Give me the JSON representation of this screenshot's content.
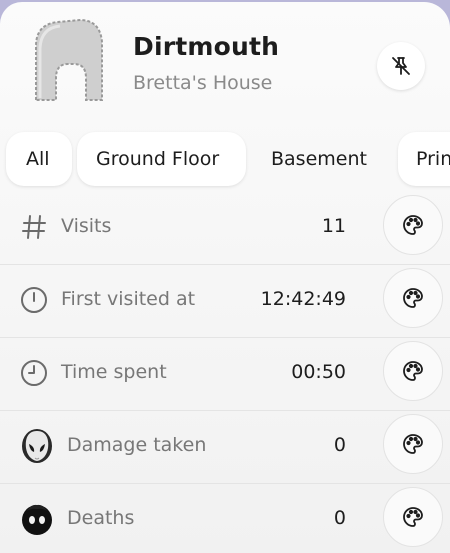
{
  "header": {
    "title": "Dirtmouth",
    "subtitle": "Bretta's House",
    "thumbnail_icon": "house-silhouette-icon",
    "unpin_icon": "pin-off-icon"
  },
  "tabs": [
    {
      "label": "All"
    },
    {
      "label": "Ground Floor"
    },
    {
      "label": "Basement"
    },
    {
      "label": "Prin"
    }
  ],
  "stats": [
    {
      "icon": "hash-icon",
      "label": "Visits",
      "value": "11"
    },
    {
      "icon": "clock-alert-icon",
      "label": "First visited at",
      "value": "12:42:49"
    },
    {
      "icon": "clock-icon",
      "label": "Time spent",
      "value": "00:50"
    },
    {
      "icon": "mask-icon",
      "label": "Damage taken",
      "value": "0"
    },
    {
      "icon": "shade-icon",
      "label": "Deaths",
      "value": "0"
    }
  ],
  "row_action_icon": "palette-icon",
  "colors": {
    "background": "#b9b7d9",
    "panel": "#f5f5f5",
    "text_primary": "#1d1d1d",
    "text_secondary": "#777777"
  }
}
